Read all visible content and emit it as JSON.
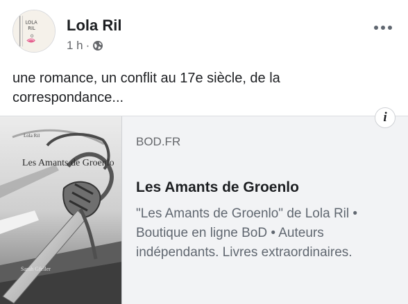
{
  "post": {
    "author_name": "Lola Ril",
    "time": "1 h",
    "separator": "·",
    "privacy_icon": "globe-icon",
    "more_icon": "more-options-icon",
    "text": "une romance, un conflit au 17e siècle, de la correspondance..."
  },
  "link_preview": {
    "info_label": "i",
    "domain": "BOD.FR",
    "title": "Les Amants de Groenlo",
    "description": "\"Les Amants de Groenlo\" de Lola Ril • Boutique en ligne BoD • Auteurs indépendants. Livres extraordinaires.",
    "thumbnail": {
      "author": "Lola Ril",
      "title": "Les Amants de Groenlo",
      "publisher": "Sarah Gfeller"
    }
  },
  "colors": {
    "text_primary": "#1c1e21",
    "text_secondary": "#65676b",
    "card_background": "#f2f3f5",
    "border": "#dadde1"
  }
}
